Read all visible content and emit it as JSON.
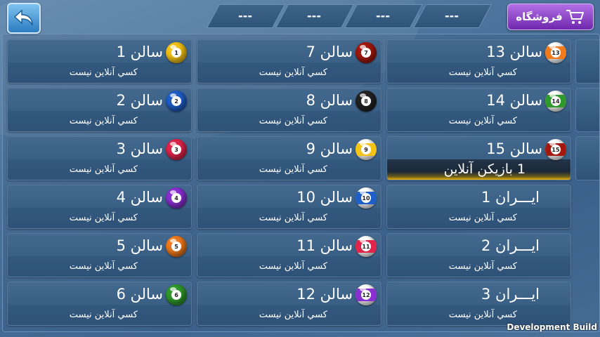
{
  "top_bar": {
    "score_slots": [
      "---",
      "---",
      "---",
      "---"
    ],
    "shop_label": "فروشگاه"
  },
  "rooms": {
    "col1": [
      {
        "name": "سالن 1",
        "status": "كسي آنلاين نيست",
        "ball": "1",
        "color": "#f3c316",
        "striped": false
      },
      {
        "name": "سالن 2",
        "status": "كسي آنلاين نيست",
        "ball": "2",
        "color": "#1f5fc9",
        "striped": false
      },
      {
        "name": "سالن 3",
        "status": "كسي آنلاين نيست",
        "ball": "3",
        "color": "#e0244a",
        "striped": false
      },
      {
        "name": "سالن 4",
        "status": "كسي آنلاين نيست",
        "ball": "4",
        "color": "#8a2fd2",
        "striped": false
      },
      {
        "name": "سالن 5",
        "status": "كسي آنلاين نيست",
        "ball": "5",
        "color": "#f07a1c",
        "striped": false
      },
      {
        "name": "سالن 6",
        "status": "كسي آنلاين نيست",
        "ball": "6",
        "color": "#2f9a2b",
        "striped": false
      }
    ],
    "col2": [
      {
        "name": "سالن 7",
        "status": "كسي آنلاين نيست",
        "ball": "7",
        "color": "#a3180e",
        "striped": false
      },
      {
        "name": "سالن 8",
        "status": "كسي آنلاين نيست",
        "ball": "8",
        "color": "#222222",
        "striped": false
      },
      {
        "name": "سالن 9",
        "status": "كسي آنلاين نيست",
        "ball": "9",
        "color": "#f3c316",
        "striped": true
      },
      {
        "name": "سالن 10",
        "status": "كسي آنلاين نيست",
        "ball": "10",
        "color": "#1f5fc9",
        "striped": true
      },
      {
        "name": "سالن 11",
        "status": "كسي آنلاين نيست",
        "ball": "11",
        "color": "#e0244a",
        "striped": true
      },
      {
        "name": "سالن 12",
        "status": "كسي آنلاين نيست",
        "ball": "12",
        "color": "#8a2fd2",
        "striped": true
      }
    ],
    "col3": [
      {
        "name": "سالن 13",
        "status": "كسي آنلاين نيست",
        "ball": "13",
        "color": "#f07a1c",
        "striped": true,
        "online": false
      },
      {
        "name": "سالن 14",
        "status": "كسي آنلاين نيست",
        "ball": "14",
        "color": "#2f9a2b",
        "striped": true,
        "online": false
      },
      {
        "name": "سالن 15",
        "status": "1 بازيکن آنلاين",
        "ball": "15",
        "color": "#a3180e",
        "striped": true,
        "online": true
      },
      {
        "name": "ايـــران 1",
        "status": "كسي آنلاين نيست",
        "ball": "",
        "color": "",
        "striped": false,
        "online": false
      },
      {
        "name": "ايـــران 2",
        "status": "كسي آنلاين نيست",
        "ball": "",
        "color": "",
        "striped": false,
        "online": false
      },
      {
        "name": "ايـــران 3",
        "status": "كسي آنلاين نيست",
        "ball": "",
        "color": "",
        "striped": false,
        "online": false
      }
    ]
  },
  "footer": {
    "dev_build": "Development Build"
  }
}
